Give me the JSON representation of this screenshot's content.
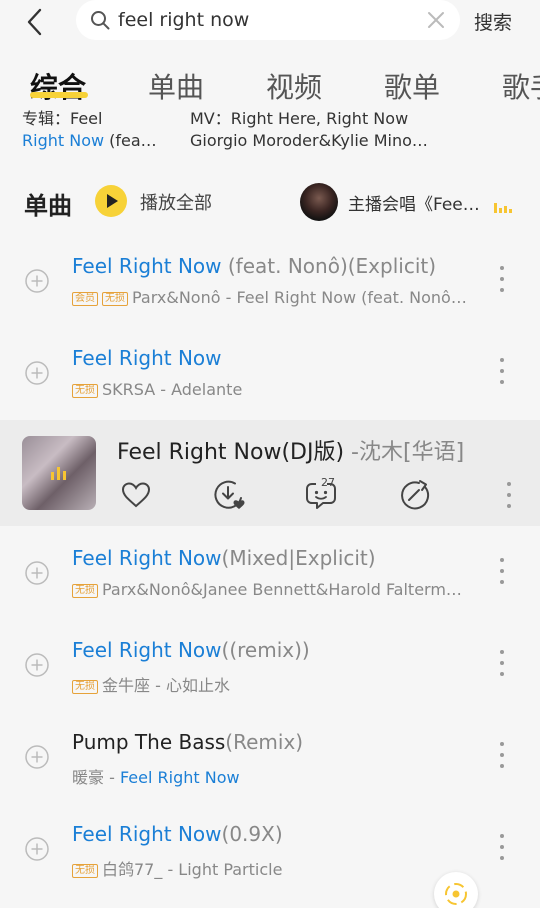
{
  "search": {
    "query": "feel right now",
    "button_label": "搜索"
  },
  "tabs": [
    {
      "label": "综合",
      "active": true
    },
    {
      "label": "单曲"
    },
    {
      "label": "视频"
    },
    {
      "label": "歌单"
    },
    {
      "label": "歌手"
    }
  ],
  "partial_cards": {
    "album_line1": "专辑：Feel",
    "album_line2_link": "Right Now",
    "album_line2_rest": " (fea…",
    "mv_line1": "MV：Right Here, Right Now",
    "mv_line2": "Giorgio Moroder&Kylie Mino…"
  },
  "section": {
    "title": "单曲",
    "play_all_label": "播放全部",
    "anchor_label": "主播会唱《Fee…"
  },
  "songs": [
    {
      "title": "Feel Right Now",
      "suffix": " (feat. Nonô)(Explicit)",
      "badges": [
        "会员",
        "无损"
      ],
      "subtitle": "Parx&Nonô - Feel Right Now (feat. Nonô…"
    },
    {
      "title": "Feel Right Now",
      "suffix": "",
      "badges": [
        "无损"
      ],
      "subtitle": "SKRSA - Adelante"
    },
    {
      "title": "Feel Right Now",
      "suffix": "(Mixed|Explicit)",
      "badges": [
        "无损"
      ],
      "subtitle": "Parx&Nonô&Janee Bennett&Harold Falterm…"
    },
    {
      "title": "Feel Right Now",
      "suffix": "((remix))",
      "badges": [
        "无损"
      ],
      "subtitle": "金牛座 - 心如止水"
    },
    {
      "title": "Pump The Bass",
      "suffix": "(Remix)",
      "artist": "暖豪",
      "subtitle_link": "Feel Right Now"
    },
    {
      "title": "Feel Right Now",
      "suffix": "(0.9X)",
      "badges": [
        "无损"
      ],
      "subtitle": "白鸽77_ - Light Particle"
    }
  ],
  "expanded": {
    "title": "Feel Right Now(DJ版)",
    "suffix": " -沈木[华语]",
    "comment_count": "27"
  },
  "colors": {
    "accent_blue": "#1b7fd6",
    "accent_yellow": "#f7d238",
    "badge_orange": "#e6a23a"
  }
}
